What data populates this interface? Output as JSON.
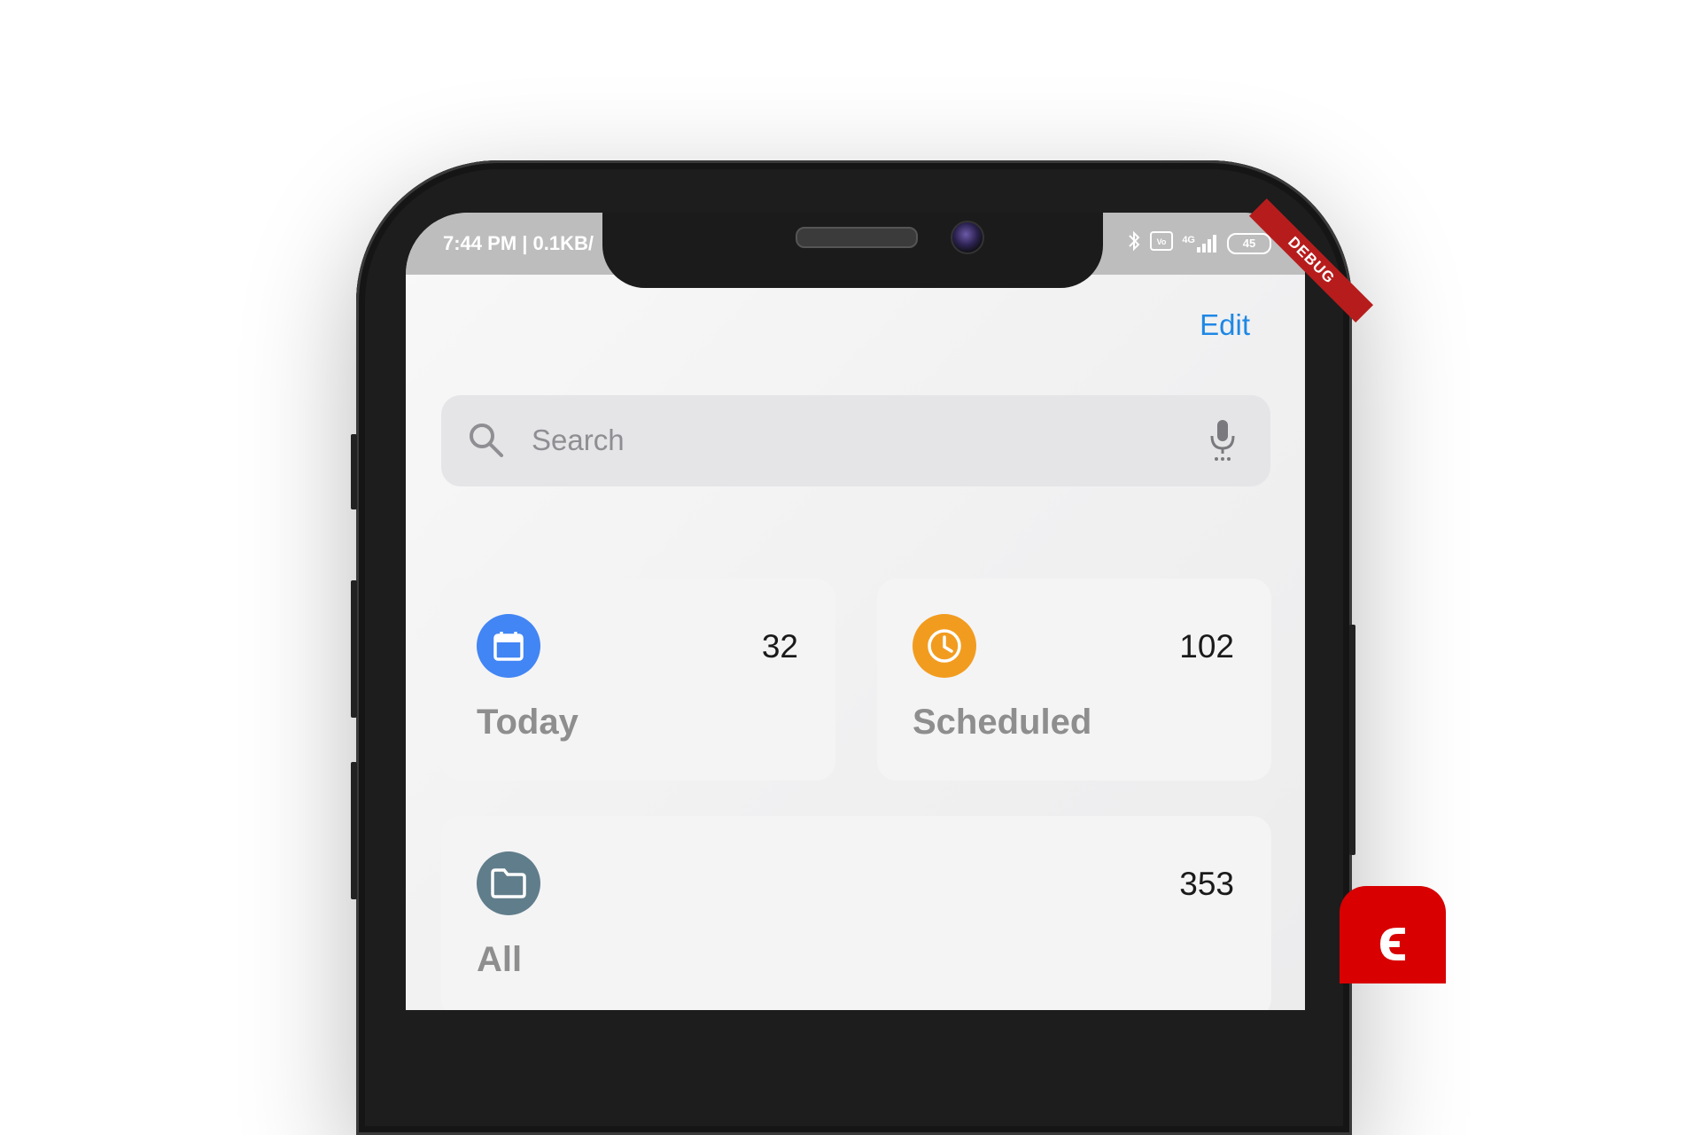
{
  "status_bar": {
    "time": "7:44 PM | 0.1KB/",
    "icons": [
      "bluetooth-icon",
      "volte-icon",
      "signal-icon"
    ],
    "network": "4G",
    "battery": "45"
  },
  "debug_banner": "DEBUG",
  "header": {
    "edit_label": "Edit"
  },
  "search": {
    "placeholder": "Search"
  },
  "cards": [
    {
      "label": "Today",
      "count": "32",
      "icon": "calendar-icon",
      "color": "#4285f4"
    },
    {
      "label": "Scheduled",
      "count": "102",
      "icon": "clock-icon",
      "color": "#f29c1f"
    },
    {
      "label": "All",
      "count": "353",
      "icon": "folder-icon",
      "color": "#607d8b"
    }
  ],
  "floating_badge": {
    "glyph": "ϵ"
  },
  "colors": {
    "accent": "#1e88e5",
    "debug": "#b71c1c",
    "badge": "#d80000"
  }
}
